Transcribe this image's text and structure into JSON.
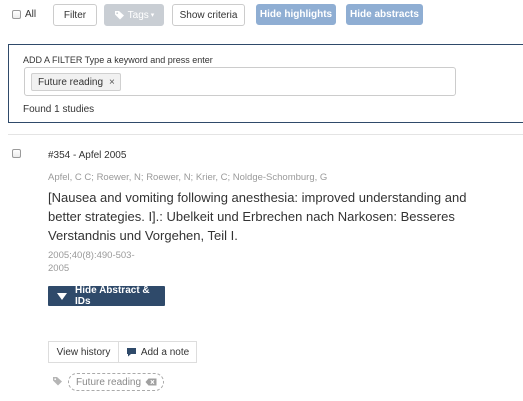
{
  "toolbar": {
    "all_label": "All",
    "filter_label": "Filter",
    "tags_label": "Tags",
    "show_criteria_label": "Show criteria",
    "hide_highlights_label": "Hide highlights",
    "hide_abstracts_label": "Hide abstracts"
  },
  "filter_panel": {
    "title": "ADD A FILTER Type a keyword and press enter",
    "active_filters": [
      "Future reading"
    ],
    "remove_symbol": "×",
    "found_text": "Found 1 studies"
  },
  "study": {
    "id_line": "#354 - Apfel 2005",
    "authors": "Apfel, C C; Roewer, N; Roewer, N; Krier, C; Noldge-Schomburg, G",
    "title": "[Nausea and vomiting following anesthesia: improved understanding and better strategies. I].: Ubelkeit und Erbrechen nach Narkosen: Besseres Verstandnis und Vorgehen, Teil I.",
    "citation": "2005;40(8):490-503-2005",
    "hide_abstract_label": "Hide Abstract & IDs",
    "view_history_label": "View history",
    "add_note_label": "Add a note",
    "tags": [
      "Future reading"
    ]
  },
  "colors": {
    "navy": "#2f4a6a",
    "light_blue_button": "#8faed3",
    "disabled_button": "#c9ced4",
    "muted_text": "#9a9a9a"
  },
  "icons": [
    "caret-down-icon",
    "tag-icon",
    "comment-icon",
    "backspace-icon",
    "checkbox"
  ]
}
